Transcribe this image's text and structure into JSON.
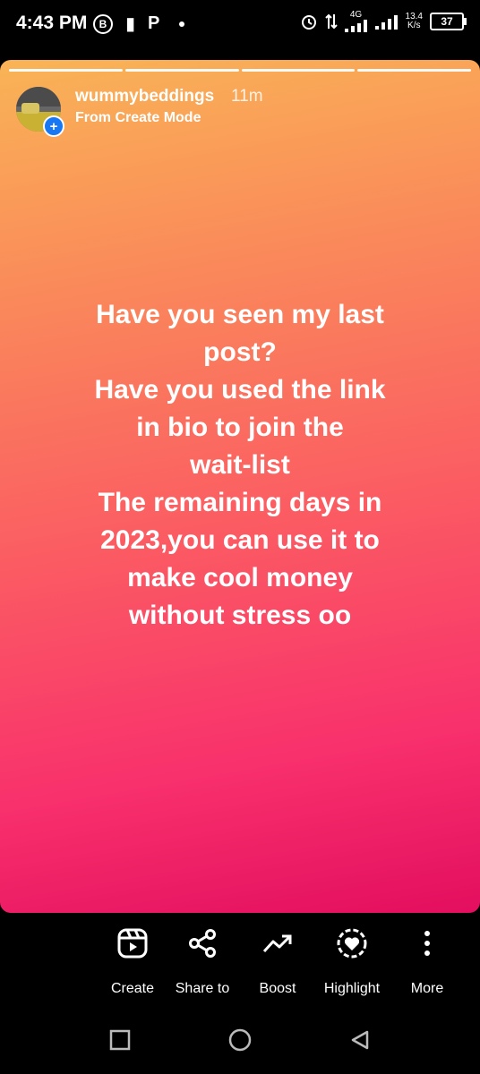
{
  "status_bar": {
    "time": "4:43 PM",
    "left_icons": [
      "b-circle-icon",
      "pay-icon",
      "p-icon",
      "dot-icon"
    ],
    "network_type": "4G",
    "speed_value": "13.4",
    "speed_unit": "K/s",
    "battery": "37"
  },
  "story": {
    "username": "wummybeddings",
    "time_ago": "11m",
    "subtitle": "From Create Mode",
    "text": "Have you seen my last\npost?\nHave you used the link\nin bio to join the\nwait-list\nThe remaining days in\n2023,you can use it to\nmake cool money\nwithout stress oo",
    "progress_segments": 4,
    "gradient_colors": [
      "#f9b456",
      "#fb5a63",
      "#e30e5f"
    ]
  },
  "actions": [
    {
      "label": "Create",
      "icon": "reels-icon"
    },
    {
      "label": "Share to",
      "icon": "share-icon"
    },
    {
      "label": "Boost",
      "icon": "trending-up-icon"
    },
    {
      "label": "Highlight",
      "icon": "highlight-heart-icon"
    },
    {
      "label": "More",
      "icon": "more-vertical-icon"
    }
  ],
  "navbar": {
    "buttons": [
      "recent-apps-icon",
      "home-icon",
      "back-icon"
    ]
  }
}
